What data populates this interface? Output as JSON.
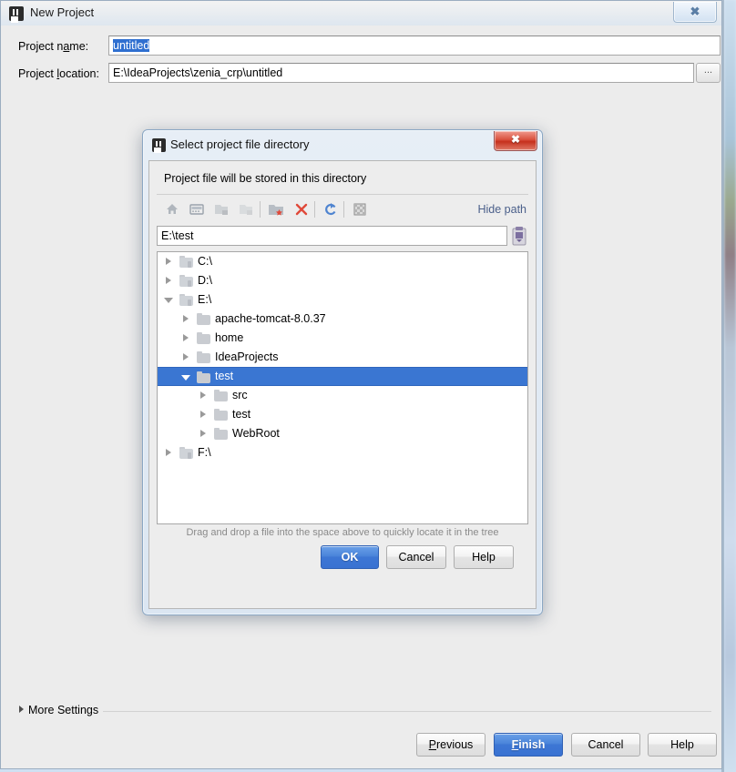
{
  "main_window": {
    "title": "New Project",
    "icon": "intellij-logo-icon",
    "close_label": "✖",
    "fields": {
      "name_label_pre": "Project n",
      "name_label_mn": "a",
      "name_label_post": "me:",
      "name_value": "untitled",
      "location_label_pre": "Project ",
      "location_label_mn": "l",
      "location_label_post": "ocation:",
      "location_value": "E:\\IdeaProjects\\zenia_crp\\untitled",
      "browse_label": "..."
    },
    "more_settings_label": "More Settings",
    "buttons": [
      {
        "label_pre": "",
        "label_mn": "P",
        "label_post": "revious",
        "name": "previous-button",
        "primary": false
      },
      {
        "label_pre": "",
        "label_mn": "F",
        "label_post": "inish",
        "name": "finish-button",
        "primary": true
      },
      {
        "label_pre": "Cancel",
        "label_mn": "",
        "label_post": "",
        "name": "cancel-button",
        "primary": false
      },
      {
        "label_pre": "Help",
        "label_mn": "",
        "label_post": "",
        "name": "help-button",
        "primary": false
      }
    ]
  },
  "dialog": {
    "title": "Select project file directory",
    "icon": "intellij-logo-icon",
    "close_label": "✖",
    "prompt": "Project file will be stored in this directory",
    "toolbar": {
      "items": [
        {
          "icon": "home-icon",
          "enabled": true
        },
        {
          "icon": "desktop-icon",
          "enabled": true
        },
        {
          "icon": "folder-down-icon",
          "enabled": false
        },
        {
          "icon": "folder-up-icon",
          "enabled": false
        },
        {
          "icon": "new-folder-icon",
          "enabled": true
        },
        {
          "icon": "delete-icon",
          "enabled": true
        },
        {
          "icon": "refresh-icon",
          "enabled": true
        },
        {
          "icon": "show-hidden-icon",
          "enabled": true
        }
      ],
      "hide_path_label": "Hide path"
    },
    "path_value": "E:\\test",
    "paste_icon": "paste-clipboard-icon",
    "tree": [
      {
        "label": "C:\\",
        "depth": 0,
        "expanded": false,
        "selected": false,
        "kind": "drive"
      },
      {
        "label": "D:\\",
        "depth": 0,
        "expanded": false,
        "selected": false,
        "kind": "drive"
      },
      {
        "label": "E:\\",
        "depth": 0,
        "expanded": true,
        "selected": false,
        "kind": "drive"
      },
      {
        "label": "apache-tomcat-8.0.37",
        "depth": 1,
        "expanded": false,
        "selected": false,
        "kind": "folder"
      },
      {
        "label": "home",
        "depth": 1,
        "expanded": false,
        "selected": false,
        "kind": "folder"
      },
      {
        "label": "IdeaProjects",
        "depth": 1,
        "expanded": false,
        "selected": false,
        "kind": "folder"
      },
      {
        "label": "test",
        "depth": 1,
        "expanded": true,
        "selected": true,
        "kind": "folder"
      },
      {
        "label": "src",
        "depth": 2,
        "expanded": false,
        "selected": false,
        "kind": "folder"
      },
      {
        "label": "test",
        "depth": 2,
        "expanded": false,
        "selected": false,
        "kind": "folder"
      },
      {
        "label": "WebRoot",
        "depth": 2,
        "expanded": false,
        "selected": false,
        "kind": "folder"
      },
      {
        "label": "F:\\",
        "depth": 0,
        "expanded": false,
        "selected": false,
        "kind": "drive"
      }
    ],
    "tree_hint": "Drag and drop a file into the space above to quickly locate it in the tree",
    "buttons": [
      {
        "label": "OK",
        "name": "ok-button",
        "primary": true
      },
      {
        "label": "Cancel",
        "name": "cancel-button",
        "primary": false
      },
      {
        "label": "Help",
        "name": "help-button",
        "primary": false
      }
    ]
  },
  "colors": {
    "selection_blue": "#3a76d2",
    "primary_button_blue": "#3d76d4",
    "link_blue": "#4a5f8a",
    "dialog_close_red": "#c6301d",
    "window_bg": "#ececec"
  }
}
